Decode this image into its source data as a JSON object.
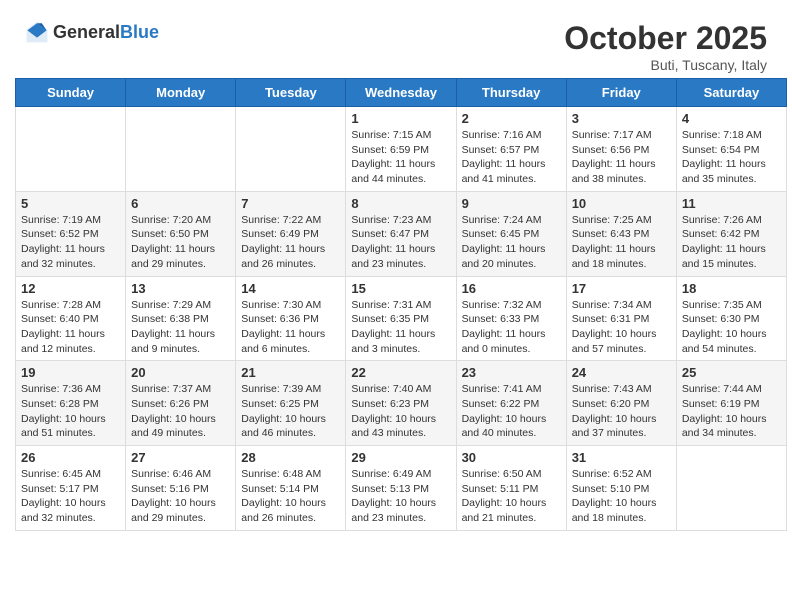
{
  "header": {
    "logo_general": "General",
    "logo_blue": "Blue",
    "month_title": "October 2025",
    "location": "Buti, Tuscany, Italy"
  },
  "days_of_week": [
    "Sunday",
    "Monday",
    "Tuesday",
    "Wednesday",
    "Thursday",
    "Friday",
    "Saturday"
  ],
  "weeks": [
    [
      {
        "day": "",
        "sunrise": "",
        "sunset": "",
        "daylight": ""
      },
      {
        "day": "",
        "sunrise": "",
        "sunset": "",
        "daylight": ""
      },
      {
        "day": "",
        "sunrise": "",
        "sunset": "",
        "daylight": ""
      },
      {
        "day": "1",
        "sunrise": "Sunrise: 7:15 AM",
        "sunset": "Sunset: 6:59 PM",
        "daylight": "Daylight: 11 hours and 44 minutes."
      },
      {
        "day": "2",
        "sunrise": "Sunrise: 7:16 AM",
        "sunset": "Sunset: 6:57 PM",
        "daylight": "Daylight: 11 hours and 41 minutes."
      },
      {
        "day": "3",
        "sunrise": "Sunrise: 7:17 AM",
        "sunset": "Sunset: 6:56 PM",
        "daylight": "Daylight: 11 hours and 38 minutes."
      },
      {
        "day": "4",
        "sunrise": "Sunrise: 7:18 AM",
        "sunset": "Sunset: 6:54 PM",
        "daylight": "Daylight: 11 hours and 35 minutes."
      }
    ],
    [
      {
        "day": "5",
        "sunrise": "Sunrise: 7:19 AM",
        "sunset": "Sunset: 6:52 PM",
        "daylight": "Daylight: 11 hours and 32 minutes."
      },
      {
        "day": "6",
        "sunrise": "Sunrise: 7:20 AM",
        "sunset": "Sunset: 6:50 PM",
        "daylight": "Daylight: 11 hours and 29 minutes."
      },
      {
        "day": "7",
        "sunrise": "Sunrise: 7:22 AM",
        "sunset": "Sunset: 6:49 PM",
        "daylight": "Daylight: 11 hours and 26 minutes."
      },
      {
        "day": "8",
        "sunrise": "Sunrise: 7:23 AM",
        "sunset": "Sunset: 6:47 PM",
        "daylight": "Daylight: 11 hours and 23 minutes."
      },
      {
        "day": "9",
        "sunrise": "Sunrise: 7:24 AM",
        "sunset": "Sunset: 6:45 PM",
        "daylight": "Daylight: 11 hours and 20 minutes."
      },
      {
        "day": "10",
        "sunrise": "Sunrise: 7:25 AM",
        "sunset": "Sunset: 6:43 PM",
        "daylight": "Daylight: 11 hours and 18 minutes."
      },
      {
        "day": "11",
        "sunrise": "Sunrise: 7:26 AM",
        "sunset": "Sunset: 6:42 PM",
        "daylight": "Daylight: 11 hours and 15 minutes."
      }
    ],
    [
      {
        "day": "12",
        "sunrise": "Sunrise: 7:28 AM",
        "sunset": "Sunset: 6:40 PM",
        "daylight": "Daylight: 11 hours and 12 minutes."
      },
      {
        "day": "13",
        "sunrise": "Sunrise: 7:29 AM",
        "sunset": "Sunset: 6:38 PM",
        "daylight": "Daylight: 11 hours and 9 minutes."
      },
      {
        "day": "14",
        "sunrise": "Sunrise: 7:30 AM",
        "sunset": "Sunset: 6:36 PM",
        "daylight": "Daylight: 11 hours and 6 minutes."
      },
      {
        "day": "15",
        "sunrise": "Sunrise: 7:31 AM",
        "sunset": "Sunset: 6:35 PM",
        "daylight": "Daylight: 11 hours and 3 minutes."
      },
      {
        "day": "16",
        "sunrise": "Sunrise: 7:32 AM",
        "sunset": "Sunset: 6:33 PM",
        "daylight": "Daylight: 11 hours and 0 minutes."
      },
      {
        "day": "17",
        "sunrise": "Sunrise: 7:34 AM",
        "sunset": "Sunset: 6:31 PM",
        "daylight": "Daylight: 10 hours and 57 minutes."
      },
      {
        "day": "18",
        "sunrise": "Sunrise: 7:35 AM",
        "sunset": "Sunset: 6:30 PM",
        "daylight": "Daylight: 10 hours and 54 minutes."
      }
    ],
    [
      {
        "day": "19",
        "sunrise": "Sunrise: 7:36 AM",
        "sunset": "Sunset: 6:28 PM",
        "daylight": "Daylight: 10 hours and 51 minutes."
      },
      {
        "day": "20",
        "sunrise": "Sunrise: 7:37 AM",
        "sunset": "Sunset: 6:26 PM",
        "daylight": "Daylight: 10 hours and 49 minutes."
      },
      {
        "day": "21",
        "sunrise": "Sunrise: 7:39 AM",
        "sunset": "Sunset: 6:25 PM",
        "daylight": "Daylight: 10 hours and 46 minutes."
      },
      {
        "day": "22",
        "sunrise": "Sunrise: 7:40 AM",
        "sunset": "Sunset: 6:23 PM",
        "daylight": "Daylight: 10 hours and 43 minutes."
      },
      {
        "day": "23",
        "sunrise": "Sunrise: 7:41 AM",
        "sunset": "Sunset: 6:22 PM",
        "daylight": "Daylight: 10 hours and 40 minutes."
      },
      {
        "day": "24",
        "sunrise": "Sunrise: 7:43 AM",
        "sunset": "Sunset: 6:20 PM",
        "daylight": "Daylight: 10 hours and 37 minutes."
      },
      {
        "day": "25",
        "sunrise": "Sunrise: 7:44 AM",
        "sunset": "Sunset: 6:19 PM",
        "daylight": "Daylight: 10 hours and 34 minutes."
      }
    ],
    [
      {
        "day": "26",
        "sunrise": "Sunrise: 6:45 AM",
        "sunset": "Sunset: 5:17 PM",
        "daylight": "Daylight: 10 hours and 32 minutes."
      },
      {
        "day": "27",
        "sunrise": "Sunrise: 6:46 AM",
        "sunset": "Sunset: 5:16 PM",
        "daylight": "Daylight: 10 hours and 29 minutes."
      },
      {
        "day": "28",
        "sunrise": "Sunrise: 6:48 AM",
        "sunset": "Sunset: 5:14 PM",
        "daylight": "Daylight: 10 hours and 26 minutes."
      },
      {
        "day": "29",
        "sunrise": "Sunrise: 6:49 AM",
        "sunset": "Sunset: 5:13 PM",
        "daylight": "Daylight: 10 hours and 23 minutes."
      },
      {
        "day": "30",
        "sunrise": "Sunrise: 6:50 AM",
        "sunset": "Sunset: 5:11 PM",
        "daylight": "Daylight: 10 hours and 21 minutes."
      },
      {
        "day": "31",
        "sunrise": "Sunrise: 6:52 AM",
        "sunset": "Sunset: 5:10 PM",
        "daylight": "Daylight: 10 hours and 18 minutes."
      },
      {
        "day": "",
        "sunrise": "",
        "sunset": "",
        "daylight": ""
      }
    ]
  ]
}
